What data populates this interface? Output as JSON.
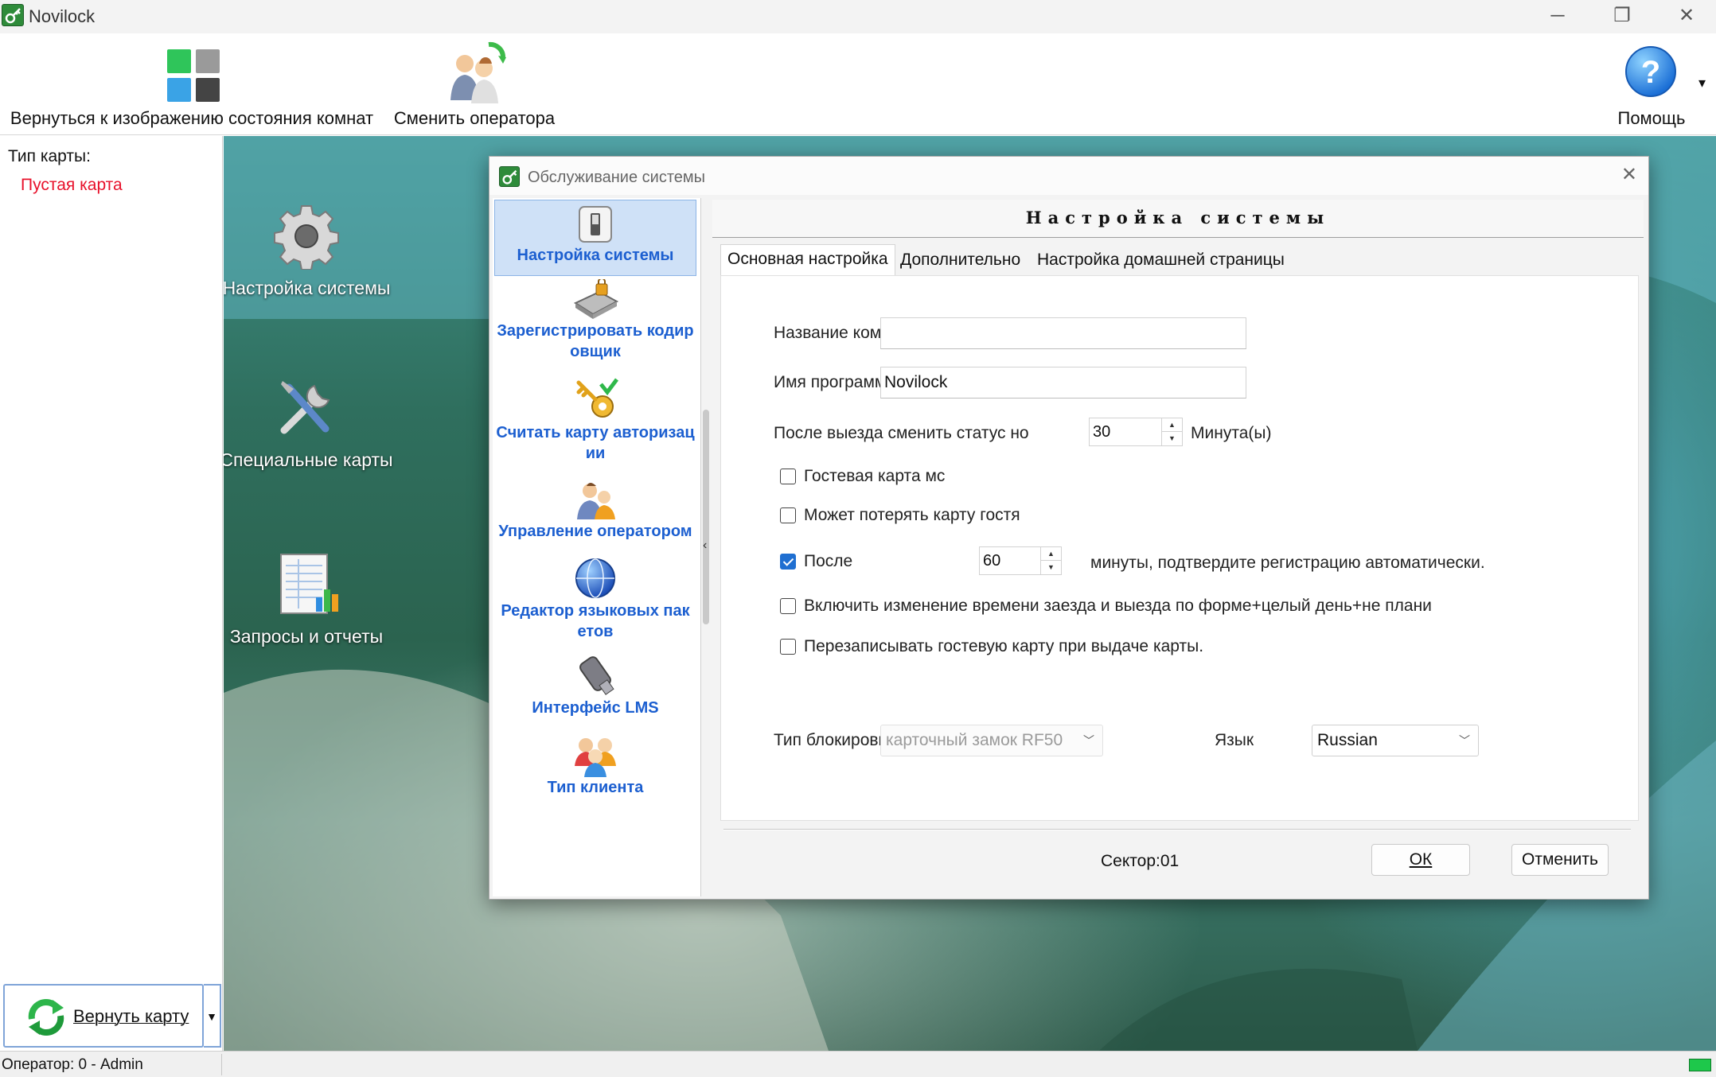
{
  "window": {
    "title": "Novilock",
    "controls": {
      "minimize": "─",
      "restore": "❐",
      "close": "✕"
    }
  },
  "toolbar": {
    "room_status_label": "Вернуться к изображению состояния комнат",
    "change_operator_label": "Сменить оператора",
    "help_label": "Помощь",
    "more_glyph": "▾"
  },
  "left_panel": {
    "card_type_label": "Тип карты:",
    "card_type_value": "Пустая карта",
    "return_card_label": "Вернуть карту",
    "return_card_dropdown": "▼"
  },
  "desktop": {
    "items": [
      {
        "label": "Настройка системы",
        "icon": "gear-icon"
      },
      {
        "label": "Специальные карты",
        "icon": "tools-icon"
      },
      {
        "label": "Запросы и отчеты",
        "icon": "reports-icon"
      }
    ]
  },
  "status_bar": {
    "text": "Оператор: 0 - Admin"
  },
  "dialog": {
    "title": "Обслуживание системы",
    "close": "✕",
    "nav": [
      {
        "label": "Настройка системы",
        "icon": "switch-icon"
      },
      {
        "label": "Зарегистрировать кодир овщик",
        "icon": "encoder-icon"
      },
      {
        "label": "Считать карту авторизац ии",
        "icon": "key-icon"
      },
      {
        "label": "Управление оператором",
        "icon": "operator-icon"
      },
      {
        "label": "Редактор языковых пак етов",
        "icon": "globe-icon"
      },
      {
        "label": "Интерфейс LMS",
        "icon": "usb-icon"
      },
      {
        "label": "Тип клиента",
        "icon": "clients-icon"
      }
    ],
    "collapse_glyph": "‹",
    "header": "Настройка системы",
    "tabs": [
      "Основная настройка",
      "Дополнительно",
      "Настройка домашней страницы"
    ],
    "form": {
      "company_label": "Название компан",
      "company_value": "",
      "program_label": "Имя программы",
      "program_value": "Novilock",
      "after_checkout_label": "После выезда сменить статус но",
      "after_checkout_value": "30",
      "after_checkout_unit": "Минута(ы)",
      "guest_card_label": "Гостевая карта мс",
      "guest_card_checked": false,
      "lose_card_label": "Может потерять карту гостя",
      "lose_card_checked": false,
      "after_label": "После",
      "after_checked": true,
      "after_value": "60",
      "after_suffix": "минуты, подтвердите регистрацию автоматически.",
      "enable_change_label": "Включить изменение времени заезда и выезда по форме+целый день+не планиро",
      "enable_change_checked": false,
      "rewrite_label": "Перезаписывать гостевую карту при выдаче карты.",
      "rewrite_checked": false,
      "lock_type_label": "Тип блокировки",
      "lock_type_value": "карточный замок RF50",
      "language_label": "Язык",
      "language_value": "Russian"
    },
    "sector": "Сектор:01",
    "ok_label": "ОК",
    "cancel_label": "Отменить"
  }
}
